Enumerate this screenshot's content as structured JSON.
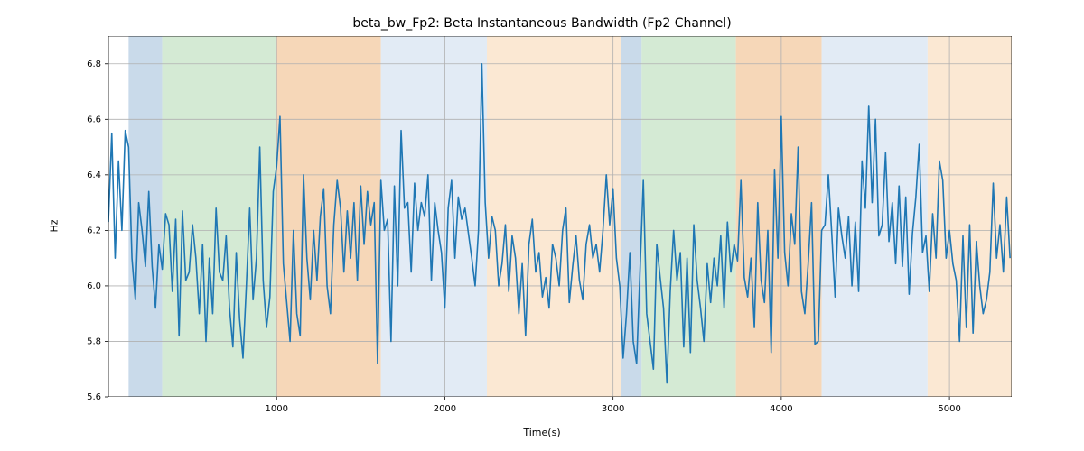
{
  "chart_data": {
    "type": "line",
    "title": "beta_bw_Fp2: Beta Instantaneous Bandwidth (Fp2 Channel)",
    "xlabel": "Time(s)",
    "ylabel": "Hz",
    "xlim": [
      0,
      5370
    ],
    "ylim": [
      5.6,
      6.9
    ],
    "xticks": [
      1000,
      2000,
      3000,
      4000,
      5000
    ],
    "yticks": [
      5.6,
      5.8,
      6.0,
      6.2,
      6.4,
      6.6,
      6.8
    ],
    "line_color": "#1f77b4",
    "regions": [
      {
        "x0": 120,
        "x1": 320,
        "color": "#c9daea"
      },
      {
        "x0": 320,
        "x1": 1000,
        "color": "#d4ead4"
      },
      {
        "x0": 1000,
        "x1": 1620,
        "color": "#f6d7b8"
      },
      {
        "x0": 1620,
        "x1": 2250,
        "color": "#e2ebf5"
      },
      {
        "x0": 2250,
        "x1": 3050,
        "color": "#fbe8d3"
      },
      {
        "x0": 3050,
        "x1": 3170,
        "color": "#c9daea"
      },
      {
        "x0": 3170,
        "x1": 3730,
        "color": "#d4ead4"
      },
      {
        "x0": 3730,
        "x1": 4240,
        "color": "#f6d7b8"
      },
      {
        "x0": 4240,
        "x1": 4870,
        "color": "#e2ebf5"
      },
      {
        "x0": 4870,
        "x1": 5370,
        "color": "#fbe8d3"
      }
    ],
    "series": [
      {
        "name": "beta_bw_Fp2",
        "x_step": 20,
        "values": [
          6.23,
          6.55,
          6.1,
          6.45,
          6.2,
          6.56,
          6.5,
          6.1,
          5.95,
          6.3,
          6.2,
          6.07,
          6.34,
          6.07,
          5.92,
          6.15,
          6.06,
          6.26,
          6.22,
          5.98,
          6.24,
          5.82,
          6.27,
          6.02,
          6.05,
          6.22,
          6.1,
          5.9,
          6.15,
          5.8,
          6.1,
          5.9,
          6.28,
          6.05,
          6.02,
          6.18,
          5.92,
          5.78,
          6.12,
          5.88,
          5.74,
          6.0,
          6.28,
          5.95,
          6.1,
          6.5,
          6.02,
          5.85,
          5.96,
          6.34,
          6.43,
          6.61,
          6.08,
          5.94,
          5.8,
          6.2,
          5.9,
          5.82,
          6.4,
          6.1,
          5.95,
          6.2,
          6.02,
          6.25,
          6.35,
          6.0,
          5.9,
          6.22,
          6.38,
          6.28,
          6.05,
          6.27,
          6.1,
          6.3,
          6.02,
          6.36,
          6.15,
          6.34,
          6.22,
          6.3,
          5.72,
          6.38,
          6.2,
          6.24,
          5.8,
          6.36,
          6.0,
          6.56,
          6.28,
          6.3,
          6.05,
          6.37,
          6.2,
          6.3,
          6.25,
          6.4,
          6.02,
          6.3,
          6.2,
          6.12,
          5.92,
          6.28,
          6.38,
          6.1,
          6.32,
          6.24,
          6.28,
          6.19,
          6.1,
          6.0,
          6.2,
          6.8,
          6.3,
          6.1,
          6.25,
          6.2,
          6.0,
          6.08,
          6.22,
          5.98,
          6.18,
          6.1,
          5.9,
          6.08,
          5.82,
          6.15,
          6.24,
          6.05,
          6.12,
          5.96,
          6.03,
          5.92,
          6.15,
          6.1,
          6.0,
          6.2,
          6.28,
          5.94,
          6.07,
          6.18,
          6.02,
          5.95,
          6.15,
          6.22,
          6.1,
          6.15,
          6.05,
          6.2,
          6.4,
          6.22,
          6.35,
          6.1,
          6.0,
          5.74,
          5.9,
          6.12,
          5.8,
          5.72,
          6.05,
          6.38,
          5.9,
          5.8,
          5.7,
          6.15,
          6.03,
          5.92,
          5.65,
          5.98,
          6.2,
          6.02,
          6.12,
          5.78,
          6.1,
          5.76,
          6.22,
          6.02,
          5.92,
          5.8,
          6.08,
          5.94,
          6.1,
          6.0,
          6.18,
          5.92,
          6.23,
          6.05,
          6.15,
          6.09,
          6.38,
          6.03,
          5.96,
          6.1,
          5.85,
          6.3,
          6.02,
          5.94,
          6.2,
          5.76,
          6.42,
          6.1,
          6.61,
          6.12,
          6.0,
          6.26,
          6.15,
          6.5,
          5.98,
          5.9,
          6.08,
          6.3,
          5.79,
          5.8,
          6.2,
          6.22,
          6.4,
          6.19,
          5.96,
          6.28,
          6.18,
          6.1,
          6.25,
          6.0,
          6.23,
          5.98,
          6.45,
          6.28,
          6.65,
          6.3,
          6.6,
          6.18,
          6.22,
          6.48,
          6.16,
          6.3,
          6.08,
          6.36,
          6.07,
          6.32,
          5.97,
          6.19,
          6.32,
          6.51,
          6.12,
          6.18,
          5.98,
          6.26,
          6.1,
          6.45,
          6.38,
          6.1,
          6.2,
          6.08,
          6.02,
          5.8,
          6.18,
          5.85,
          6.22,
          5.83,
          6.16,
          6.0,
          5.9,
          5.95,
          6.05,
          6.37,
          6.1,
          6.22,
          6.05,
          6.32,
          6.1
        ]
      }
    ]
  }
}
